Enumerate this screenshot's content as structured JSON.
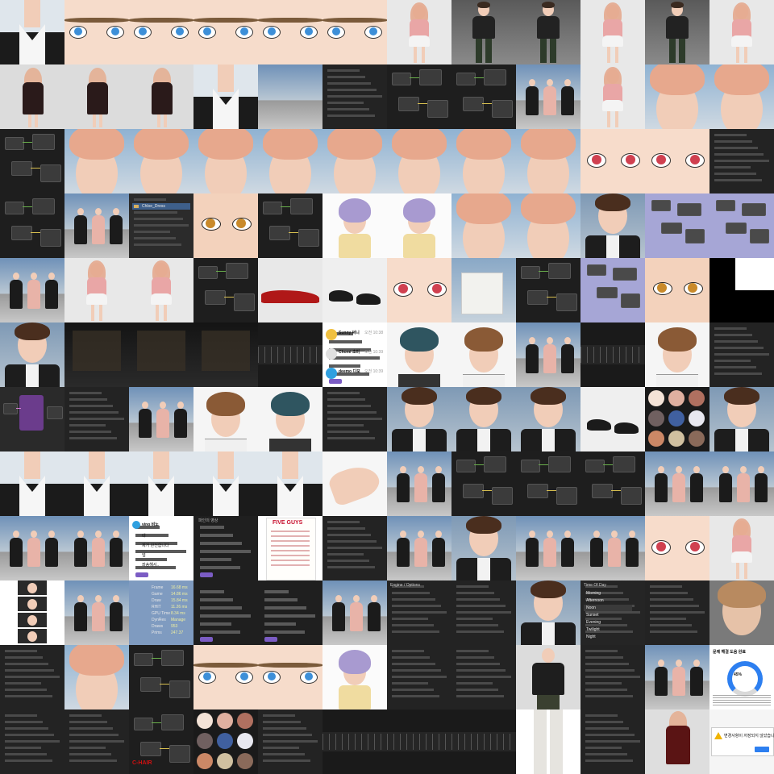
{
  "gallery": {
    "columns": 12,
    "rows": 12,
    "tile_count": 144
  },
  "text_labels": {
    "asset_item": "Chloe_Dress",
    "chat_1_name": "Sunny 써니",
    "chat_1_time": "오전 10:38",
    "chat_2_name": "Chomi 초미",
    "chat_2_time": "오전 10:39",
    "chat_3_name": "deemo 디모",
    "chat_3_time": "오전 10:39",
    "stats_rows": [
      "Frame",
      "Game",
      "Draw",
      "RHIT",
      "GPU Time",
      "DynRes",
      "Draws",
      "Prims"
    ],
    "stats_values": [
      "16.68 ms",
      "14.86 ms",
      "15.84 ms",
      "11.26 ms",
      "8.34 ms",
      "Manage",
      "953",
      "247.37"
    ],
    "chat_msg_name": "vino 비노",
    "chat_msg_lines": [
      "네",
      "제거 완전합니다",
      "넵",
      "좌송해서.."
    ],
    "poster_title": "FIVE GUYS",
    "menu_title": "Time Of Day",
    "menu_items": [
      "Morning",
      "Afternoon",
      "Noon",
      "Sunset",
      "Evening",
      "Twilight",
      "Night"
    ],
    "panel_title": "Engine / Options",
    "korean_panel_title": "파인의 영상",
    "red_note": "C-HAIR",
    "alert_text": "변경사항이 저장되지 않았습니다",
    "gauge_title": "문제 해결 도움 완료",
    "gauge_label": "45%"
  },
  "colors": {
    "editor_bg": "#1e1e1e",
    "node_bg": "#3b3b3b",
    "sky": "#9cb7cf",
    "skin": "#f3d3c0",
    "pink_hair": "#e8a98c",
    "suit": "#1a1a1a",
    "accent_purple": "#7b5cc4"
  }
}
